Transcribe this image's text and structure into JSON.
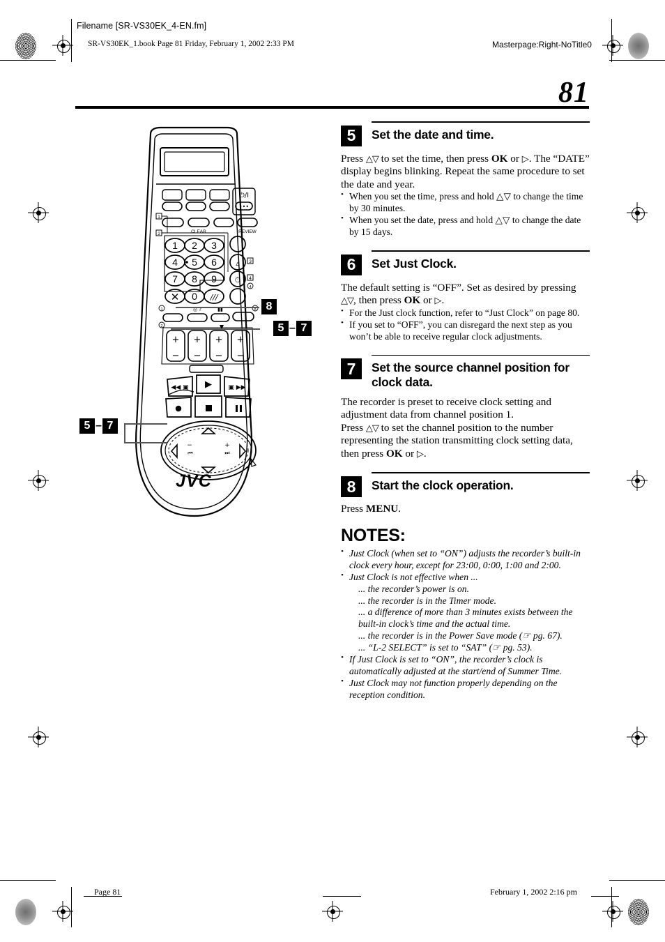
{
  "header": {
    "filename": "Filename [SR-VS30EK_4-EN.fm]",
    "bookline": "SR-VS30EK_1.book  Page 81  Friday, February 1, 2002  2:33 PM",
    "masterpage": "Masterpage:Right-NoTitle0"
  },
  "page": {
    "number": "81"
  },
  "footer": {
    "left": "Page 81",
    "right": "February 1, 2002 2:16 pm"
  },
  "steps": [
    {
      "num": "5",
      "title": "Set the date and time.",
      "body_1": "Press ",
      "body_arrows": "△▽",
      "body_2": " to set the time, then press ",
      "body_ok": "OK",
      "body_3": " or ",
      "body_tri": "▷",
      "body_4": ". The “DATE” display begins blinking. Repeat the same procedure to set the date and year.",
      "bullets": [
        "When you set the time, press and hold △▽ to change the time by 30 minutes.",
        "When you set the date, press and hold △▽ to change the date by 15 days."
      ]
    },
    {
      "num": "6",
      "title": "Set Just Clock.",
      "body_1": "The default setting is “OFF”. Set as desired by pressing ",
      "body_arrows": "△▽",
      "body_2": ", then press ",
      "body_ok": "OK",
      "body_3": " or ",
      "body_tri": "▷",
      "body_4": ".",
      "bullets": [
        "For the Just clock function, refer to “Just Clock” on page 80.",
        "If you set to “OFF”, you can disregard the next step as you won’t be able to receive regular clock adjustments."
      ]
    },
    {
      "num": "7",
      "title": "Set the source channel position for clock data.",
      "body_1": "The recorder is preset to receive clock setting and adjustment data from channel position 1.",
      "body_2": "Press ",
      "body_arrows": "△▽",
      "body_3": " to set the channel position to the number representing the station transmitting clock setting data, then press ",
      "body_ok": "OK",
      "body_4": " or ",
      "body_tri": "▷",
      "body_5": ".",
      "bullets": []
    },
    {
      "num": "8",
      "title": "Start the clock operation.",
      "body_1": "Press ",
      "body_menu": "MENU",
      "body_2": ".",
      "bullets": []
    }
  ],
  "notes": {
    "title": "NOTES:",
    "items": [
      {
        "text": "Just Clock (when set to “ON”) adjusts the recorder’s built-in clock every hour, except for 23:00, 0:00, 1:00 and 2:00.",
        "subs": []
      },
      {
        "text": "Just Clock is not effective when ...",
        "subs": [
          "... the recorder’s power is on.",
          "... the recorder is in the Timer mode.",
          "... a difference of more than 3 minutes exists between the built-in clock’s time and the actual time.",
          "... the recorder is in the Power Save mode (☞ pg. 67).",
          "... “L-2 SELECT” is set to “SAT” (☞ pg. 53)."
        ]
      },
      {
        "text": "If Just Clock is set to “ON”, the recorder’s clock is automatically adjusted at the start/end of Summer Time.",
        "subs": []
      },
      {
        "text": "Just Clock may not function properly depending on the reception condition.",
        "subs": []
      }
    ]
  },
  "figure": {
    "brand": "JVC",
    "power_label": "⏻/I",
    "keys": [
      "1",
      "2",
      "3",
      "4",
      "5",
      "6",
      "7",
      "8",
      "9",
      "0"
    ],
    "labels": {
      "clear": "CLEAR",
      "review": "REVIEW"
    },
    "callouts": [
      {
        "id": "callout-8",
        "primary": "8",
        "secondary": ""
      },
      {
        "id": "callout-5-7-right",
        "primary": "5",
        "dash": "–",
        "secondary": "7"
      },
      {
        "id": "callout-5-7-left",
        "primary": "5",
        "dash": "–",
        "secondary": "7"
      }
    ],
    "index_marks": [
      "1",
      "2",
      "3",
      "4"
    ]
  }
}
